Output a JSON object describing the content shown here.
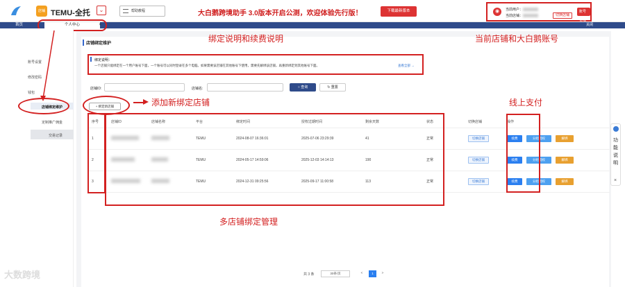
{
  "header": {
    "app_name": "TEMU-全托",
    "store_badge": "店铺",
    "help_label": "帮助教程",
    "notice": "大白鹅跨境助手 3.0版本开启公测，欢迎体验先行版！",
    "download_label": "下载最新版本",
    "current_user_label": "当前用户：",
    "current_store_label": "当前店铺：",
    "switch_store_label": "切换店铺",
    "account_mgmt_label": "账号管理"
  },
  "tabs": {
    "home": "首页",
    "active": "个人中心",
    "close": "×",
    "right": "关闭"
  },
  "sidebar": {
    "items": [
      {
        "label": "账号设置"
      },
      {
        "label": "修改密码"
      },
      {
        "label": "钱包"
      },
      {
        "label": "店铺绑定维护"
      },
      {
        "label": "定制推广佣金"
      },
      {
        "label": "交易记录"
      }
    ]
  },
  "page": {
    "title": "店铺绑定维护",
    "desc_title": "绑定说明：",
    "desc_text": "一个店铺只能绑定在一个用户账号下面，一个账号可以同时登录在多个电脑。如果需要该店铺在其他账号下使用，需要先解绑该店铺，再重新绑定到其他账号下面。",
    "desc_more": "查看全部 →",
    "store_id_label": "店铺ID:",
    "store_name_label": "店铺名:",
    "query_label": "查询",
    "reset_label": "重置",
    "add_label": "+ 绑定新店铺"
  },
  "annotations": {
    "bind_desc": "绑定说明和续费说明",
    "account": "当前店铺和大白鹅账号",
    "add_store": "添加新绑定店铺",
    "pay": "线上支付",
    "multi": "多店铺绑定管理"
  },
  "table": {
    "columns": [
      "序号",
      "店铺ID",
      "店铺名称",
      "平台",
      "绑定时间",
      "授权过期时间",
      "剩余天数",
      "状态",
      "切换店铺",
      "操作"
    ],
    "rows": [
      {
        "no": "1",
        "platform": "TEMU",
        "bind_time": "2024-08-07 16:36:01",
        "expire_time": "2025-07-06 23:29:39",
        "days": "41",
        "status": "正常"
      },
      {
        "no": "2",
        "platform": "TEMU",
        "bind_time": "2024-05-17 14:59:06",
        "expire_time": "2025-12-03 14:14:13",
        "days": "190",
        "status": "正常"
      },
      {
        "no": "3",
        "platform": "TEMU",
        "bind_time": "2024-12-31 09:25:56",
        "expire_time": "2025-09-17 11:00:58",
        "days": "113",
        "status": "正常"
      }
    ],
    "switch_label": "切换店铺",
    "renew_label": "续费",
    "manage_label": "分组授权",
    "unbind_label": "解绑"
  },
  "pager": {
    "total": "共 3 条",
    "page_size": "30条/页",
    "prev": "<",
    "current": "1",
    "next": ">"
  },
  "float_panel": {
    "label": "功能说明",
    "close": "×"
  },
  "watermark": "大数跨境",
  "colors": {
    "primary": "#2f4b8a",
    "annotation_red": "#d32020",
    "renew_blue": "#2a7ff0",
    "unbind_orange": "#e8a030"
  }
}
